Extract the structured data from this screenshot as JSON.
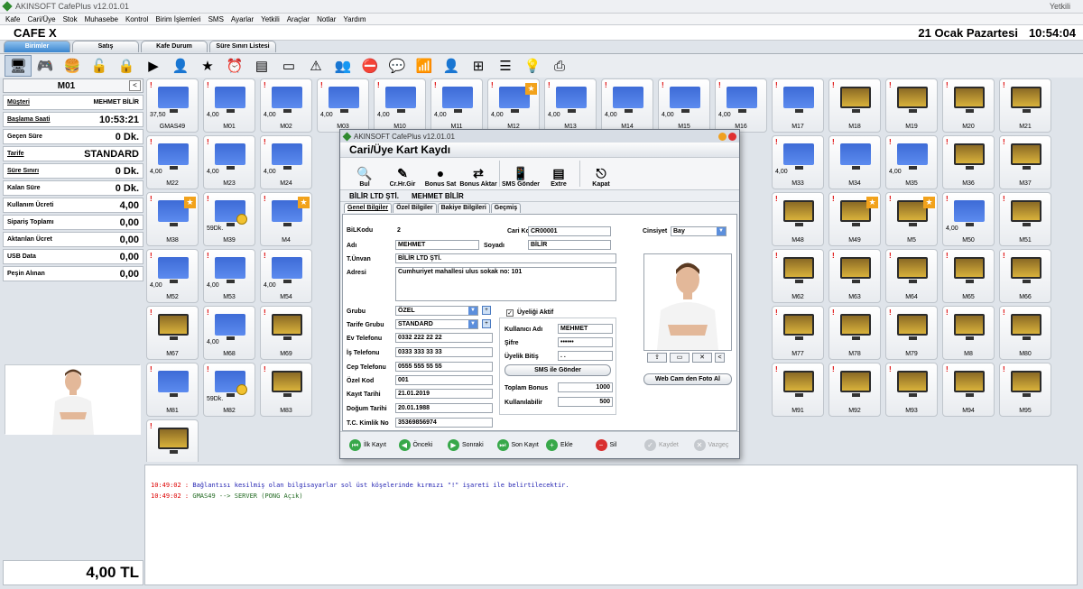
{
  "window": {
    "title": "AKINSOFT CafePlus v12.01.01",
    "user": "Yetkili"
  },
  "menu": [
    "Kafe",
    "Cari/Üye",
    "Stok",
    "Muhasebe",
    "Kontrol",
    "Birim İşlemleri",
    "SMS",
    "Ayarlar",
    "Yetkili",
    "Araçlar",
    "Notlar",
    "Yardım"
  ],
  "header": {
    "cafe": "CAFE X",
    "date": "21 Ocak Pazartesi",
    "time": "10:54:04"
  },
  "tabs": [
    "Birimler",
    "Satış",
    "Kafe Durum",
    "Süre Sınırı Listesi"
  ],
  "toolbar_icons": [
    "monitor-icon",
    "gamepad-icon",
    "burger-icon",
    "lock-open-icon",
    "lock-icon",
    "play-icon",
    "person-icon",
    "star-icon",
    "clock-icon",
    "note-icon",
    "screen-icon",
    "warning-icon",
    "users-icon",
    "stop-icon",
    "chat-icon",
    "chart-icon",
    "user-search-icon",
    "network-icon",
    "list-icon",
    "bulb-icon",
    "printer-icon"
  ],
  "left": {
    "unit": "M01",
    "rows": [
      {
        "label": "Müşteri",
        "value": "MEHMET BİLİR",
        "underline": true,
        "small": true
      },
      {
        "label": "Başlama Saati",
        "value": "10:53:21",
        "underline": true
      },
      {
        "label": "Geçen Süre",
        "value": "0 Dk."
      },
      {
        "label": "Tarife",
        "value": "STANDARD",
        "underline": true
      },
      {
        "label": "Süre Sınırı",
        "value": "0 Dk.",
        "underline": true
      },
      {
        "label": "Kalan Süre",
        "value": "0 Dk."
      },
      {
        "label": "Kullanım Ücreti",
        "value": "4,00"
      },
      {
        "label": "Sipariş Toplamı",
        "value": "0,00"
      },
      {
        "label": "Aktarılan Ücret",
        "value": "0,00"
      },
      {
        "label": "USB Data",
        "value": "0,00"
      },
      {
        "label": "Peşin Alınan",
        "value": "0,00"
      }
    ],
    "total": "4,00 TL"
  },
  "tiles": [
    {
      "label": "GMAS49",
      "amt": "37,50",
      "type": "pc"
    },
    {
      "label": "M01",
      "amt": "4,00",
      "type": "pc"
    },
    {
      "label": "M02",
      "amt": "4,00",
      "type": "pc"
    },
    {
      "label": "M03",
      "amt": "4,00",
      "type": "pc"
    },
    {
      "label": "M10",
      "amt": "4,00",
      "type": "pc"
    },
    {
      "label": "M11",
      "amt": "4,00",
      "type": "pc"
    },
    {
      "label": "M12",
      "amt": "4,00",
      "type": "pc",
      "star": true
    },
    {
      "label": "M13",
      "amt": "4,00",
      "type": "pc"
    },
    {
      "label": "M14",
      "amt": "4,00",
      "type": "pc"
    },
    {
      "label": "M15",
      "amt": "4,00",
      "type": "pc"
    },
    {
      "label": "M16",
      "amt": "4,00",
      "type": "pc"
    },
    {
      "label": "M17",
      "amt": "",
      "type": "pc"
    },
    {
      "label": "M18",
      "amt": "",
      "type": "game"
    },
    {
      "label": "M19",
      "amt": "",
      "type": "game"
    },
    {
      "label": "M20",
      "amt": "",
      "type": "game"
    },
    {
      "label": "M21",
      "amt": "",
      "type": "game"
    },
    {
      "label": "M22",
      "amt": "4,00",
      "type": "pc"
    },
    {
      "label": "M23",
      "amt": "4,00",
      "type": "pc"
    },
    {
      "label": "M24",
      "amt": "4,00",
      "type": "pc"
    },
    {
      "label": "",
      "amt": "",
      "type": "hidden"
    },
    {
      "label": "",
      "amt": "",
      "type": "hidden"
    },
    {
      "label": "",
      "amt": "",
      "type": "hidden"
    },
    {
      "label": "",
      "amt": "",
      "type": "hidden"
    },
    {
      "label": "",
      "amt": "",
      "type": "hidden"
    },
    {
      "label": "",
      "amt": "",
      "type": "hidden"
    },
    {
      "label": "",
      "amt": "",
      "type": "hidden"
    },
    {
      "label": "",
      "amt": "",
      "type": "hidden"
    },
    {
      "label": "M33",
      "amt": "4,00",
      "type": "pc"
    },
    {
      "label": "M34",
      "amt": "",
      "type": "pc"
    },
    {
      "label": "M35",
      "amt": "4,00",
      "type": "pc"
    },
    {
      "label": "M36",
      "amt": "",
      "type": "game"
    },
    {
      "label": "M37",
      "amt": "",
      "type": "game"
    },
    {
      "label": "M38",
      "amt": "",
      "type": "pc",
      "star": true
    },
    {
      "label": "M39",
      "amt": "59Dk.",
      "type": "pc",
      "clock": true
    },
    {
      "label": "M4",
      "amt": "",
      "type": "pc",
      "star": true
    },
    {
      "label": "",
      "amt": "",
      "type": "hidden"
    },
    {
      "label": "",
      "amt": "",
      "type": "hidden"
    },
    {
      "label": "",
      "amt": "",
      "type": "hidden"
    },
    {
      "label": "",
      "amt": "",
      "type": "hidden"
    },
    {
      "label": "",
      "amt": "",
      "type": "hidden"
    },
    {
      "label": "",
      "amt": "",
      "type": "hidden"
    },
    {
      "label": "",
      "amt": "",
      "type": "hidden"
    },
    {
      "label": "",
      "amt": "",
      "type": "hidden"
    },
    {
      "label": "M48",
      "amt": "",
      "type": "game"
    },
    {
      "label": "M49",
      "amt": "",
      "type": "game",
      "star": true
    },
    {
      "label": "M5",
      "amt": "",
      "type": "game",
      "star": true
    },
    {
      "label": "M50",
      "amt": "4,00",
      "type": "pc"
    },
    {
      "label": "M51",
      "amt": "",
      "type": "game"
    },
    {
      "label": "M52",
      "amt": "4,00",
      "type": "pc"
    },
    {
      "label": "M53",
      "amt": "4,00",
      "type": "pc"
    },
    {
      "label": "M54",
      "amt": "4,00",
      "type": "pc"
    },
    {
      "label": "",
      "amt": "",
      "type": "hidden"
    },
    {
      "label": "",
      "amt": "",
      "type": "hidden"
    },
    {
      "label": "",
      "amt": "",
      "type": "hidden"
    },
    {
      "label": "",
      "amt": "",
      "type": "hidden"
    },
    {
      "label": "",
      "amt": "",
      "type": "hidden"
    },
    {
      "label": "",
      "amt": "",
      "type": "hidden"
    },
    {
      "label": "",
      "amt": "",
      "type": "hidden"
    },
    {
      "label": "",
      "amt": "",
      "type": "hidden"
    },
    {
      "label": "M62",
      "amt": "",
      "type": "game"
    },
    {
      "label": "M63",
      "amt": "",
      "type": "game"
    },
    {
      "label": "M64",
      "amt": "",
      "type": "game"
    },
    {
      "label": "M65",
      "amt": "",
      "type": "game"
    },
    {
      "label": "M66",
      "amt": "",
      "type": "game"
    },
    {
      "label": "M67",
      "amt": "",
      "type": "game"
    },
    {
      "label": "M68",
      "amt": "4,00",
      "type": "pc"
    },
    {
      "label": "M69",
      "amt": "",
      "type": "game"
    },
    {
      "label": "",
      "amt": "",
      "type": "hidden"
    },
    {
      "label": "",
      "amt": "",
      "type": "hidden"
    },
    {
      "label": "",
      "amt": "",
      "type": "hidden"
    },
    {
      "label": "",
      "amt": "",
      "type": "hidden"
    },
    {
      "label": "",
      "amt": "",
      "type": "hidden"
    },
    {
      "label": "",
      "amt": "",
      "type": "hidden"
    },
    {
      "label": "",
      "amt": "",
      "type": "hidden"
    },
    {
      "label": "",
      "amt": "",
      "type": "hidden"
    },
    {
      "label": "M77",
      "amt": "",
      "type": "game"
    },
    {
      "label": "M78",
      "amt": "",
      "type": "game"
    },
    {
      "label": "M79",
      "amt": "",
      "type": "game"
    },
    {
      "label": "M8",
      "amt": "",
      "type": "game"
    },
    {
      "label": "M80",
      "amt": "",
      "type": "game"
    },
    {
      "label": "M81",
      "amt": "",
      "type": "pc"
    },
    {
      "label": "M82",
      "amt": "59Dk.",
      "type": "pc",
      "clock": true
    },
    {
      "label": "M83",
      "amt": "",
      "type": "game"
    },
    {
      "label": "",
      "amt": "",
      "type": "hidden"
    },
    {
      "label": "",
      "amt": "",
      "type": "hidden"
    },
    {
      "label": "",
      "amt": "",
      "type": "hidden"
    },
    {
      "label": "",
      "amt": "",
      "type": "hidden"
    },
    {
      "label": "",
      "amt": "",
      "type": "hidden"
    },
    {
      "label": "",
      "amt": "",
      "type": "hidden"
    },
    {
      "label": "",
      "amt": "",
      "type": "hidden"
    },
    {
      "label": "",
      "amt": "",
      "type": "hidden"
    },
    {
      "label": "M91",
      "amt": "",
      "type": "game"
    },
    {
      "label": "M92",
      "amt": "",
      "type": "game"
    },
    {
      "label": "M93",
      "amt": "",
      "type": "game"
    },
    {
      "label": "M94",
      "amt": "",
      "type": "game"
    },
    {
      "label": "M95",
      "amt": "",
      "type": "game"
    },
    {
      "label": "",
      "amt": "",
      "type": "game"
    }
  ],
  "log": [
    {
      "time": "10:49:02 :",
      "msg": "Bağlantısı kesilmiş olan bilgisayarlar sol üst köşelerinde kırmızı \"!\" işareti ile belirtilecektir."
    },
    {
      "time": "10:49:02 :",
      "msg": "GMAS49 --> SERVER (PONG Açık)"
    }
  ],
  "modal": {
    "title": "AKINSOFT CafePlus v12.01.01",
    "heading": "Cari/Üye Kart Kaydı",
    "tools": [
      {
        "icon": "search-icon",
        "label": "Bul"
      },
      {
        "icon": "edit-icon",
        "label": "Cr.Hr.Gir"
      },
      {
        "icon": "coin-icon",
        "label": "Bonus Sat"
      },
      {
        "icon": "transfer-icon",
        "label": "Bonus Aktar"
      },
      {
        "icon": "phone-icon",
        "label": "SMS Gönder"
      },
      {
        "icon": "extra-icon",
        "label": "Extre"
      },
      {
        "icon": "exit-icon",
        "label": "Kapat"
      }
    ],
    "company": "BİLİR LTD ŞTİ.",
    "person": "MEHMET BİLİR",
    "tabs": [
      "Genel Bilgiler",
      "Özel Bilgiler",
      "Bakiye Bilgileri",
      "Geçmiş"
    ],
    "fields": {
      "bilkodu_l": "BiLKodu",
      "bilkodu": "2",
      "carikodu_l": "Cari Kodu",
      "carikodu": "CR00001",
      "cinsiyet_l": "Cinsiyet",
      "cinsiyet": "Bay",
      "adi_l": "Adı",
      "adi": "MEHMET",
      "soyadi_l": "Soyadı",
      "soyadi": "BİLİR",
      "unvan_l": "T.Ünvan",
      "unvan": "BİLİR LTD ŞTİ.",
      "adres_l": "Adresi",
      "adres": "Cumhuriyet mahallesi ulus sokak no: 101",
      "grubu_l": "Grubu",
      "grubu": "ÖZEL",
      "tarife_l": "Tarife Grubu",
      "tarife": "STANDARD",
      "ev_l": "Ev Telefonu",
      "ev": "0332 222 22 22",
      "is_l": "İş Telefonu",
      "is": "0333 333 33 33",
      "cep_l": "Cep Telefonu",
      "cep": "0555 555 55 55",
      "ozel_l": "Özel Kod",
      "ozel": "001",
      "kayit_l": "Kayıt Tarihi",
      "kayit": "21.01.2019",
      "dogum_l": "Doğum Tarihi",
      "dogum": "20.01.1988",
      "tc_l": "T.C. Kimlik No",
      "tc": "35369856974",
      "uyelik_aktif": "Üyeliği Aktif",
      "kadi_l": "Kullanıcı Adı",
      "kadi": "MEHMET",
      "sifre_l": "Şifre",
      "sifre": "••••••",
      "bitis_l": "Üyelik Bitiş",
      "bitis": ". .",
      "sms_btn": "SMS ile Gönder",
      "bonus_l": "Toplam Bonus",
      "bonus": "1000",
      "kullan_l": "Kullanılabilir",
      "kullan": "500",
      "webcam": "Web Cam den Foto Al"
    },
    "footer": [
      {
        "label": "İlk Kayıt",
        "icon": "first-icon",
        "red": false,
        "disabled": false
      },
      {
        "label": "Önceki",
        "icon": "prev-icon",
        "red": false,
        "disabled": false
      },
      {
        "label": "Sonraki",
        "icon": "next-icon",
        "red": false,
        "disabled": false
      },
      {
        "label": "Son Kayıt",
        "icon": "last-icon",
        "red": false,
        "disabled": false
      },
      {
        "label": "Ekle",
        "icon": "add-icon",
        "red": false,
        "disabled": false
      },
      {
        "label": "Sil",
        "icon": "delete-icon",
        "red": true,
        "disabled": false
      },
      {
        "label": "Kaydet",
        "icon": "save-icon",
        "red": false,
        "disabled": true
      },
      {
        "label": "Vazgeç",
        "icon": "cancel-icon",
        "red": false,
        "disabled": true
      }
    ]
  }
}
